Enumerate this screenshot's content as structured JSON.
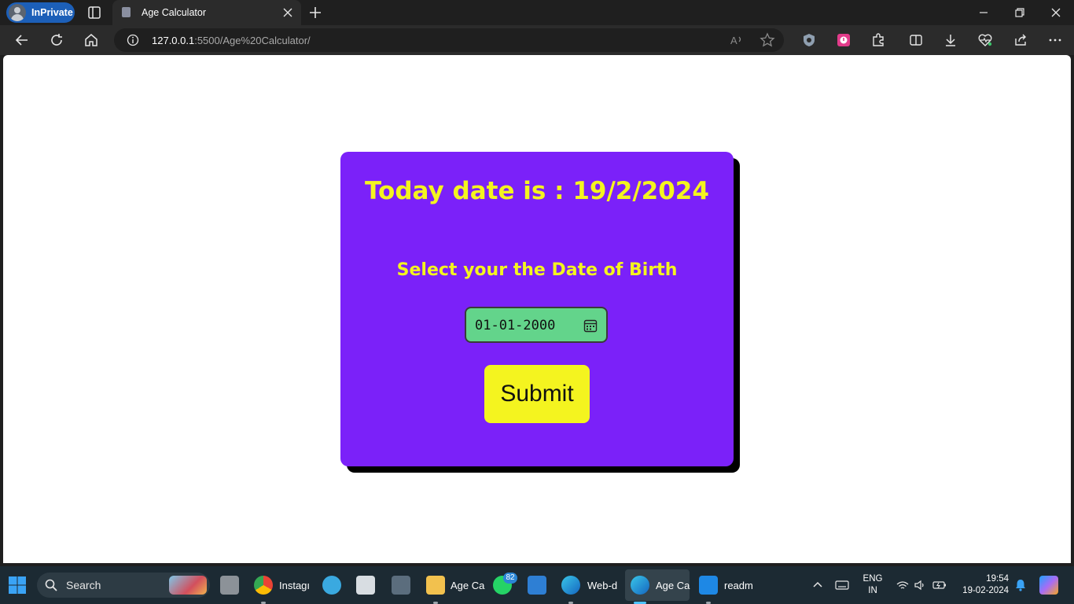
{
  "browser": {
    "inprivate_label": "InPrivate",
    "tab": {
      "title": "Age Calculator"
    },
    "address": {
      "host": "127.0.0.1",
      "rest": ":5500/Age%20Calculator/"
    }
  },
  "page": {
    "today_text": "Today date is : 19/2/2024",
    "dob_prompt": "Select your the Date of Birth",
    "dob_value": "01-01-2000",
    "submit_label": "Submit",
    "colors": {
      "card": "#7b21f9",
      "heading": "#f4f41f",
      "input": "#63d48b",
      "button": "#f4f41f"
    }
  },
  "taskbar": {
    "search_placeholder": "Search",
    "items": [
      {
        "name": "chrome",
        "label": "Instagı"
      },
      {
        "name": "file-explorer",
        "label": "Age Ca"
      },
      {
        "name": "whatsapp",
        "badge": "82"
      },
      {
        "name": "edge-web",
        "label": "Web-d"
      },
      {
        "name": "edge-age",
        "label": "Age Ca"
      },
      {
        "name": "vscode",
        "label": "readm"
      }
    ],
    "lang_line1": "ENG",
    "lang_line2": "IN",
    "time": "19:54",
    "date": "19-02-2024"
  }
}
